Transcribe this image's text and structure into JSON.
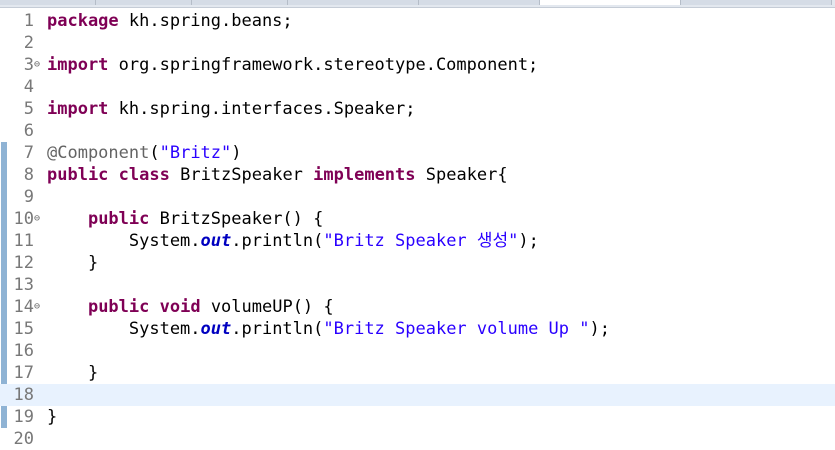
{
  "editor": {
    "lines": [
      {
        "num": "1",
        "fold": "",
        "tokens": [
          [
            "kw",
            "package"
          ],
          [
            "t",
            " kh.spring.beans;"
          ]
        ]
      },
      {
        "num": "2",
        "fold": "",
        "tokens": []
      },
      {
        "num": "3",
        "fold": "⊖",
        "tokens": [
          [
            "kw",
            "import"
          ],
          [
            "t",
            " org.springframework.stereotype.Component;"
          ]
        ]
      },
      {
        "num": "4",
        "fold": "",
        "tokens": []
      },
      {
        "num": "5",
        "fold": "",
        "tokens": [
          [
            "kw",
            "import"
          ],
          [
            "t",
            " kh.spring.interfaces.Speaker;"
          ]
        ]
      },
      {
        "num": "6",
        "fold": "",
        "tokens": []
      },
      {
        "num": "7",
        "fold": "",
        "tokens": [
          [
            "ann",
            "@Component"
          ],
          [
            "t",
            "("
          ],
          [
            "str",
            "\"Britz\""
          ],
          [
            "t",
            ")"
          ]
        ]
      },
      {
        "num": "8",
        "fold": "",
        "tokens": [
          [
            "kw",
            "public"
          ],
          [
            "t",
            " "
          ],
          [
            "kw",
            "class"
          ],
          [
            "t",
            " BritzSpeaker "
          ],
          [
            "kw",
            "implements"
          ],
          [
            "t",
            " Speaker{"
          ]
        ]
      },
      {
        "num": "9",
        "fold": "",
        "tokens": []
      },
      {
        "num": "10",
        "fold": "⊖",
        "tokens": [
          [
            "t",
            "    "
          ],
          [
            "kw",
            "public"
          ],
          [
            "t",
            " BritzSpeaker() {"
          ]
        ]
      },
      {
        "num": "11",
        "fold": "",
        "tokens": [
          [
            "t",
            "        System."
          ],
          [
            "stat",
            "out"
          ],
          [
            "t",
            ".println("
          ],
          [
            "str",
            "\"Britz Speaker 생성\""
          ],
          [
            "t",
            ");"
          ]
        ]
      },
      {
        "num": "12",
        "fold": "",
        "tokens": [
          [
            "t",
            "    }"
          ]
        ]
      },
      {
        "num": "13",
        "fold": "",
        "tokens": []
      },
      {
        "num": "14",
        "fold": "⊖",
        "tokens": [
          [
            "t",
            "    "
          ],
          [
            "kw",
            "public"
          ],
          [
            "t",
            " "
          ],
          [
            "kw",
            "void"
          ],
          [
            "t",
            " volumeUP() {"
          ]
        ]
      },
      {
        "num": "15",
        "fold": "",
        "tokens": [
          [
            "t",
            "        System."
          ],
          [
            "stat",
            "out"
          ],
          [
            "t",
            ".println("
          ],
          [
            "str",
            "\"Britz Speaker volume Up \""
          ],
          [
            "t",
            ");"
          ]
        ]
      },
      {
        "num": "16",
        "fold": "",
        "tokens": []
      },
      {
        "num": "17",
        "fold": "",
        "tokens": [
          [
            "t",
            "    }"
          ]
        ]
      },
      {
        "num": "18",
        "fold": "",
        "tokens": []
      },
      {
        "num": "19",
        "fold": "",
        "tokens": [
          [
            "t",
            "}"
          ]
        ]
      },
      {
        "num": "20",
        "fold": "",
        "tokens": []
      }
    ],
    "current_line": "18",
    "changed_lines": [
      "7",
      "8",
      "9",
      "10",
      "11",
      "12",
      "13",
      "14",
      "15",
      "16",
      "17",
      "18",
      "19"
    ]
  }
}
